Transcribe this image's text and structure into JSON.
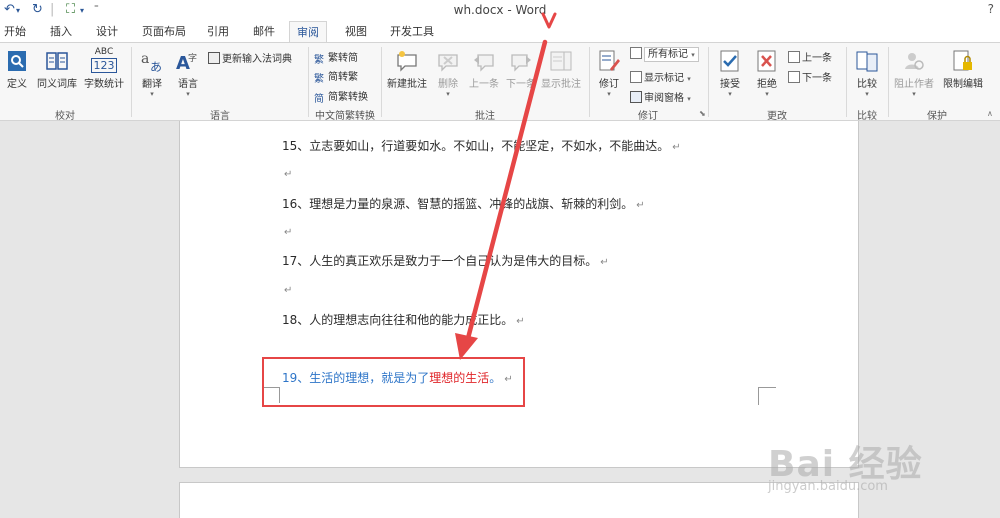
{
  "window": {
    "title": "wh.docx - Word",
    "help": "?"
  },
  "tabs": [
    {
      "label": "开始"
    },
    {
      "label": "插入"
    },
    {
      "label": "设计"
    },
    {
      "label": "页面布局"
    },
    {
      "label": "引用"
    },
    {
      "label": "邮件"
    },
    {
      "label": "审阅"
    },
    {
      "label": "视图"
    },
    {
      "label": "开发工具"
    }
  ],
  "ribbon": {
    "proofing": {
      "label": "校对",
      "define": "定义",
      "thesaurus": "同义词库",
      "wordcount": "字数统计",
      "abc_top": "ABC",
      "abc_bottom": "123"
    },
    "language": {
      "label": "语言",
      "translate": "翻译",
      "language": "语言",
      "update_ime": "更新输入法词典"
    },
    "chinese": {
      "label": "中文简繁转换",
      "to_trad": "繁转简",
      "to_simp": "简转繁",
      "convert": "简繁转换"
    },
    "comments": {
      "label": "批注",
      "new": "新建批注",
      "delete": "删除",
      "prev": "上一条",
      "next": "下一条",
      "show": "显示批注"
    },
    "tracking": {
      "label": "修订",
      "track": "修订",
      "markup_combo": "所有标记",
      "show_markup": "显示标记",
      "pane": "审阅窗格"
    },
    "changes": {
      "label": "更改",
      "accept": "接受",
      "reject": "拒绝",
      "prev": "上一条",
      "next": "下一条"
    },
    "compare": {
      "label": "比较",
      "compare": "比较"
    },
    "protect": {
      "label": "保护",
      "block_authors": "阻止作者",
      "restrict": "限制编辑"
    }
  },
  "document": {
    "p15": "15、立志要如山，行道要如水。不如山，不能坚定，不如水，不能曲达。",
    "p16": "16、理想是力量的泉源、智慧的摇篮、冲锋的战旗、斩棘的利剑。",
    "p17": "17、人生的真正欢乐是致力于一个自己认为是伟大的目标。",
    "p18": "18、人的理想志向往往和他的能力成正比。",
    "p19_blue": "19、生活的理想，就是为了",
    "p19_red": "理想的生活",
    "p19_end": "。",
    "para_mark": "↵"
  },
  "watermark": {
    "main": "Bai 经验",
    "sub": "jingyan.baidu.com"
  },
  "colors": {
    "accent": "#2b579a",
    "annotation": "#e64646",
    "blue_text": "#2e75c8",
    "red_text": "#e0262a"
  }
}
